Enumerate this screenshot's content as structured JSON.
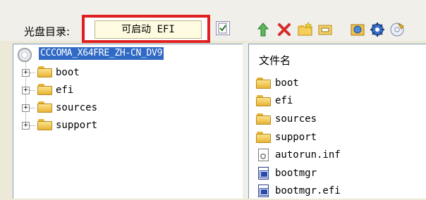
{
  "toolbar": {
    "cd_dir_label": "光盘目录:",
    "boot_type_value": "可启动 EFI",
    "icons": [
      "checkbox-icon",
      "up-arrow-icon",
      "delete-icon",
      "new-folder-icon",
      "rename-icon",
      "properties-icon",
      "settings-icon",
      "extract-icon"
    ]
  },
  "tree": {
    "root_label": "CCCOMA_X64FRE_ZH-CN_DV9",
    "items": [
      {
        "label": "boot",
        "expander": "+"
      },
      {
        "label": "efi",
        "expander": "+"
      },
      {
        "label": "sources",
        "expander": "+"
      },
      {
        "label": "support",
        "expander": "+"
      }
    ]
  },
  "file_list": {
    "header": "文件名",
    "items": [
      {
        "label": "boot",
        "icon": "folder-icon"
      },
      {
        "label": "efi",
        "icon": "folder-icon"
      },
      {
        "label": "sources",
        "icon": "folder-icon"
      },
      {
        "label": "support",
        "icon": "folder-icon"
      },
      {
        "label": "autorun.inf",
        "icon": "config-file-icon"
      },
      {
        "label": "bootmgr",
        "icon": "system-file-icon"
      },
      {
        "label": "bootmgr.efi",
        "icon": "system-file-icon"
      }
    ]
  },
  "colors": {
    "highlight_border": "#e02020",
    "selection": "#316ac5",
    "window_bg": "#f0efea"
  }
}
